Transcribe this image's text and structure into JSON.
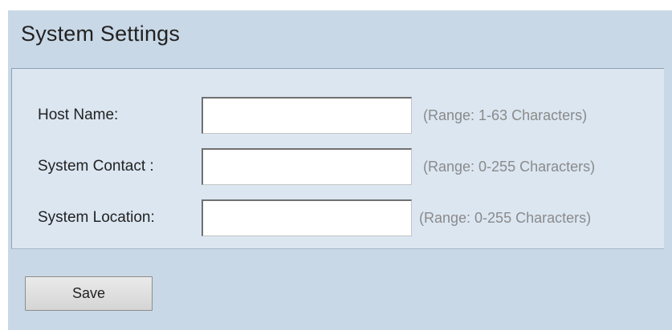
{
  "page": {
    "title": "System Settings"
  },
  "form": {
    "fields": [
      {
        "label": "Host Name:",
        "value": "",
        "hint": "(Range: 1-63 Characters)"
      },
      {
        "label": "System Contact :",
        "value": "",
        "hint": "(Range: 0-255 Characters)"
      },
      {
        "label": "System Location:",
        "value": "",
        "hint": "(Range: 0-255 Characters)"
      }
    ],
    "save_label": "Save"
  }
}
